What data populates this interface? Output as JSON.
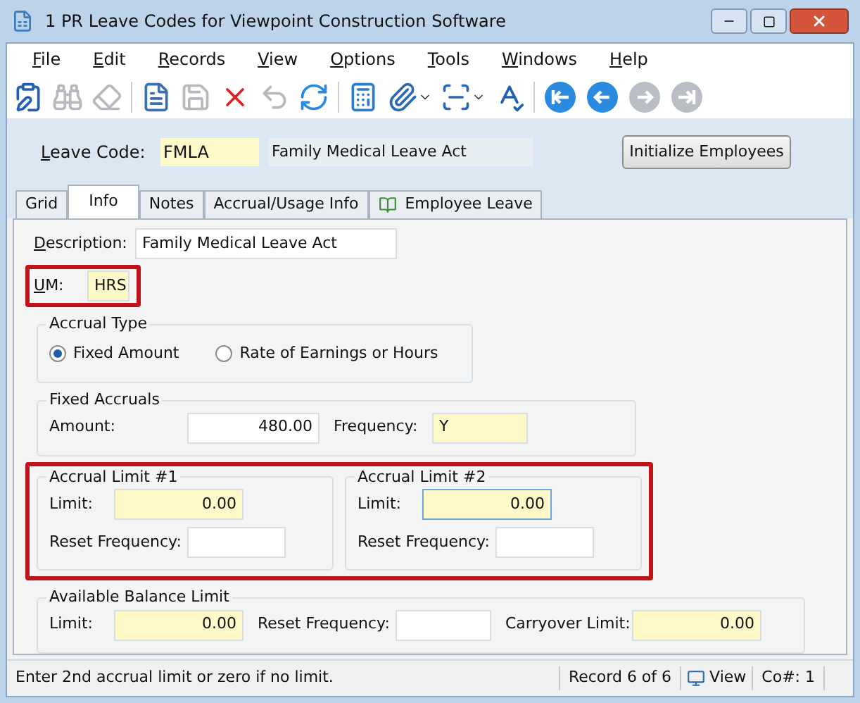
{
  "window": {
    "title": "1 PR Leave Codes for Viewpoint Construction Software"
  },
  "menu": [
    "File",
    "Edit",
    "Records",
    "View",
    "Options",
    "Tools",
    "Windows",
    "Help"
  ],
  "toolbar": [
    {
      "disabled": false
    },
    {
      "disabled": true
    },
    {
      "disabled": true
    },
    {
      "disabled": false
    },
    {
      "disabled": true
    },
    {
      "disabled": false
    },
    {
      "disabled": true
    },
    {
      "disabled": false
    },
    {
      "disabled": false
    },
    {
      "disabled": false
    },
    {
      "disabled": false
    },
    {
      "disabled": false
    },
    {
      "disabled": false
    },
    {
      "disabled": false
    },
    {
      "disabled": true
    },
    {
      "disabled": true
    }
  ],
  "header": {
    "leave_code_label": "Leave Code:",
    "leave_code": "FMLA",
    "leave_description": "Family Medical Leave Act",
    "button": "Initialize Employees"
  },
  "tabs": [
    {
      "label": "Grid",
      "selected": false,
      "kind": "plain"
    },
    {
      "label": "Info",
      "selected": true,
      "kind": "plain"
    },
    {
      "label": "Notes",
      "selected": false,
      "kind": "plain"
    },
    {
      "label": "Accrual/Usage Info",
      "selected": false,
      "kind": "plain"
    },
    {
      "label": "Employee Leave",
      "selected": false,
      "kind": "icon"
    }
  ],
  "description": {
    "label": "Description:",
    "value": "Family Medical Leave Act",
    "required": false,
    "focused": false
  },
  "um": {
    "label": "UM:",
    "value": "HRS",
    "required": true,
    "focused": false
  },
  "accrual_type": {
    "title": "Accrual Type",
    "options": [
      {
        "label": "Fixed Amount",
        "selected": true
      },
      {
        "label": "Rate of Earnings or Hours",
        "selected": false
      }
    ]
  },
  "fixed_accruals": {
    "title": "Fixed Accruals",
    "fields": [
      {
        "label": "Amount:",
        "value": "480.00",
        "required": false,
        "focused": false,
        "kind": "number"
      },
      {
        "label": "Frequency:",
        "value": "Y",
        "required": true,
        "focused": false,
        "kind": "text"
      }
    ]
  },
  "accrual_limits": [
    {
      "title": "Accrual Limit #1",
      "fields": [
        {
          "label": "Limit:",
          "value": "0.00",
          "required": true,
          "focused": false,
          "kind": "number"
        },
        {
          "label": "Reset Frequency:",
          "required": false,
          "focused": false,
          "kind": "text"
        }
      ]
    },
    {
      "title": "Accrual Limit #2",
      "fields": [
        {
          "label": "Limit:",
          "value": "0.00",
          "required": true,
          "focused": true,
          "kind": "number"
        },
        {
          "label": "Reset Frequency:",
          "required": false,
          "focused": false,
          "kind": "text"
        }
      ]
    }
  ],
  "available_balance": {
    "title": "Available Balance Limit",
    "fields": [
      {
        "label": "Limit:",
        "value": "0.00",
        "required": true,
        "focused": false,
        "kind": "number"
      },
      {
        "label": "Reset Frequency:",
        "required": false,
        "focused": false,
        "kind": "text"
      },
      {
        "label": "Carryover Limit:",
        "value": "0.00",
        "required": true,
        "focused": false,
        "kind": "number"
      }
    ]
  },
  "status_bar": {
    "message": "Enter 2nd accrual limit or zero if no limit.",
    "record": "Record 6 of 6",
    "mode": "View",
    "company": "Co#: 1"
  }
}
